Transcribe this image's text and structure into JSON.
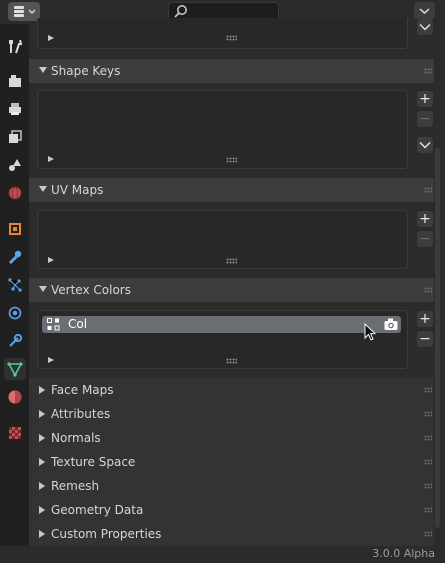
{
  "status": {
    "version": "3.0.0 Alpha"
  },
  "sections": {
    "shape_keys": "Shape Keys",
    "uv_maps": "UV Maps",
    "vertex_colors": "Vertex Colors"
  },
  "vertex_colors": {
    "items": [
      {
        "name": "Col"
      }
    ]
  },
  "collapsed": {
    "face_maps": "Face Maps",
    "attributes": "Attributes",
    "normals": "Normals",
    "texture_space": "Texture Space",
    "remesh": "Remesh",
    "geometry_data": "Geometry Data",
    "custom_properties": "Custom Properties"
  },
  "buttons": {
    "add": "+",
    "remove": "−"
  }
}
